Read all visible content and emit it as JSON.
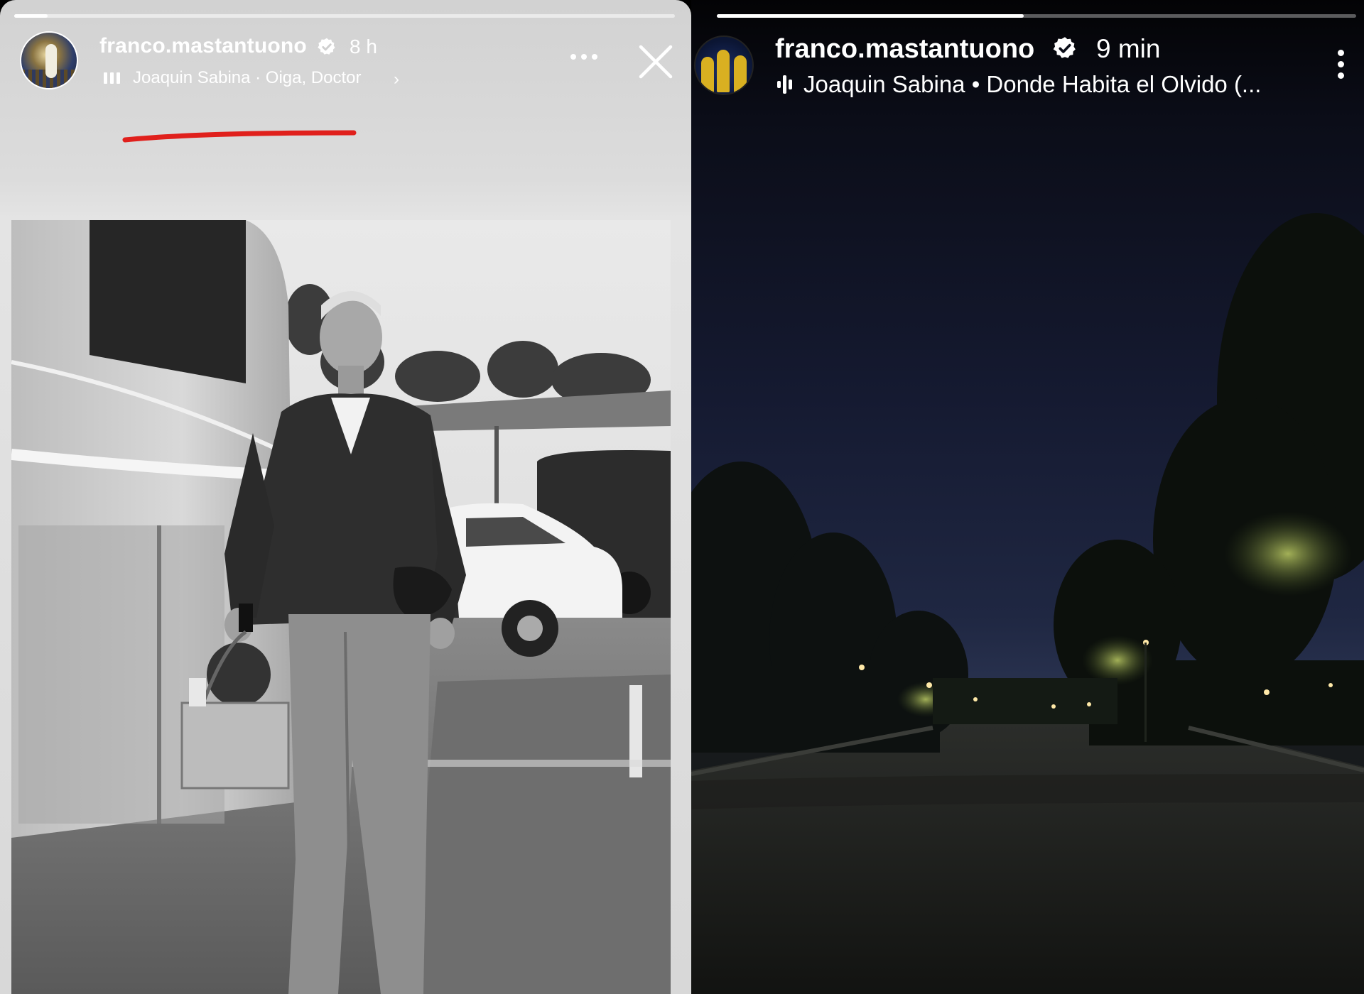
{
  "left_story": {
    "username": "franco.mastantuono",
    "time": "8 h",
    "music": "Joaquin Sabina · Oiga, Doctor",
    "progress": 0.05,
    "icons": {
      "verified": "verified-badge-icon",
      "music": "music-bars-icon",
      "more": "more-options-icon",
      "close": "close-icon",
      "chevron": "chevron-right-icon"
    },
    "chevron_glyph": "›",
    "annotation_color": "#e0201c"
  },
  "right_story": {
    "username": "franco.mastantuono",
    "time": "9 min",
    "music": "Joaquin Sabina • Donde Habita el Olvido (...",
    "progress": 0.48,
    "icons": {
      "verified": "verified-badge-icon",
      "music": "audio-wave-icon",
      "more": "kebab-menu-icon"
    }
  }
}
